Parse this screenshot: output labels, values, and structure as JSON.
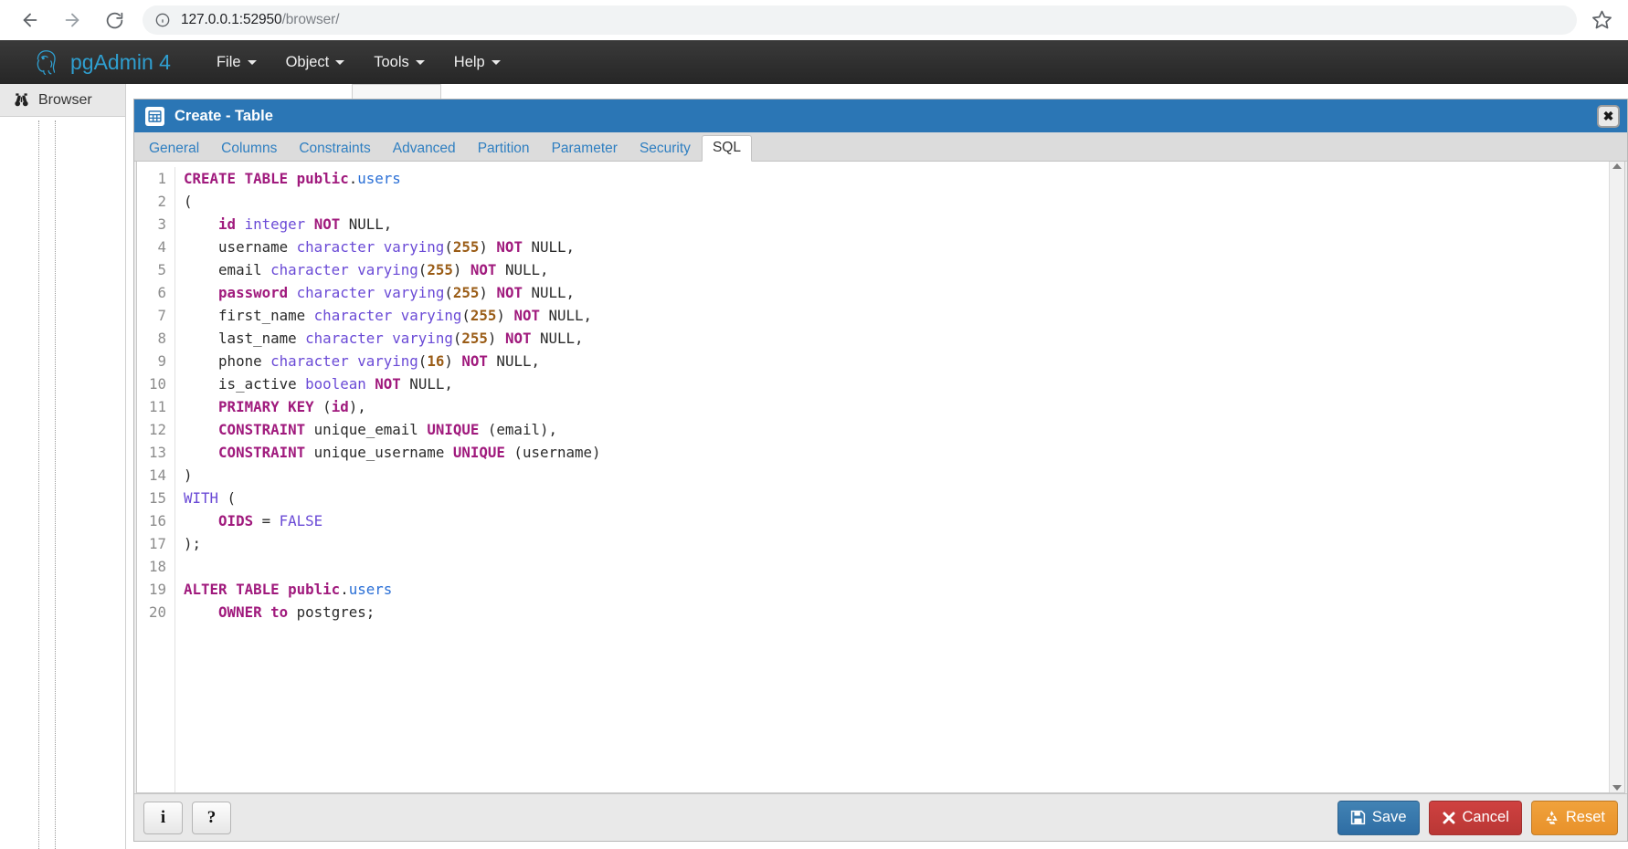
{
  "browser": {
    "url_host": "127.0.0.1:52950",
    "url_path": "/browser/",
    "back_icon": "arrow-left-icon",
    "forward_icon": "arrow-right-icon",
    "reload_icon": "reload-icon",
    "info_icon": "info-circle-icon",
    "star_icon": "star-icon"
  },
  "app": {
    "brand": "pgAdmin 4",
    "logo_icon": "postgresql-elephant-icon",
    "menus": [
      {
        "label": "File"
      },
      {
        "label": "Object"
      },
      {
        "label": "Tools"
      },
      {
        "label": "Help"
      }
    ]
  },
  "browser_panel": {
    "title": "Browser",
    "icon": "binoculars-icon"
  },
  "dialog": {
    "title": "Create - Table",
    "icon": "table-icon",
    "close_label": "✖",
    "tabs": [
      {
        "label": "General",
        "active": false
      },
      {
        "label": "Columns",
        "active": false
      },
      {
        "label": "Constraints",
        "active": false
      },
      {
        "label": "Advanced",
        "active": false
      },
      {
        "label": "Partition",
        "active": false
      },
      {
        "label": "Parameter",
        "active": false
      },
      {
        "label": "Security",
        "active": false
      },
      {
        "label": "SQL",
        "active": true
      }
    ],
    "active_tab": "SQL",
    "footer": {
      "info_label": "i",
      "help_label": "?",
      "save_label": "Save",
      "cancel_label": "Cancel",
      "reset_label": "Reset",
      "save_icon": "floppy-disk-icon",
      "cancel_icon": "x-mark-icon",
      "reset_icon": "recycle-icon"
    }
  },
  "sql": {
    "language": "postgresql",
    "line_count": 20,
    "line_numbers": [
      1,
      2,
      3,
      4,
      5,
      6,
      7,
      8,
      9,
      10,
      11,
      12,
      13,
      14,
      15,
      16,
      17,
      18,
      19,
      20
    ],
    "plain_text": "CREATE TABLE public.users\n(\n    id integer NOT NULL,\n    username character varying(255) NOT NULL,\n    email character varying(255) NOT NULL,\n    password character varying(255) NOT NULL,\n    first_name character varying(255) NOT NULL,\n    last_name character varying(255) NOT NULL,\n    phone character varying(16) NOT NULL,\n    is_active boolean NOT NULL,\n    PRIMARY KEY (id),\n    CONSTRAINT unique_email UNIQUE (email),\n    CONSTRAINT unique_username UNIQUE (username)\n)\nWITH (\n    OIDS = FALSE\n);\n\nALTER TABLE public.users\n    OWNER to postgres;",
    "lines": [
      {
        "n": 1,
        "tokens": [
          {
            "t": "k",
            "v": "CREATE TABLE public"
          },
          {
            "t": "pl",
            "v": "."
          },
          {
            "t": "obj",
            "v": "users"
          }
        ]
      },
      {
        "n": 2,
        "tokens": [
          {
            "t": "pl",
            "v": "("
          }
        ]
      },
      {
        "n": 3,
        "tokens": [
          {
            "t": "pl",
            "v": "    "
          },
          {
            "t": "k",
            "v": "id"
          },
          {
            "t": "pl",
            "v": " "
          },
          {
            "t": "t",
            "v": "integer"
          },
          {
            "t": "pl",
            "v": " "
          },
          {
            "t": "k",
            "v": "NOT"
          },
          {
            "t": "pl",
            "v": " NULL,"
          }
        ]
      },
      {
        "n": 4,
        "tokens": [
          {
            "t": "pl",
            "v": "    username "
          },
          {
            "t": "t",
            "v": "character varying"
          },
          {
            "t": "pl",
            "v": "("
          },
          {
            "t": "num",
            "v": "255"
          },
          {
            "t": "pl",
            "v": ") "
          },
          {
            "t": "k",
            "v": "NOT"
          },
          {
            "t": "pl",
            "v": " NULL,"
          }
        ]
      },
      {
        "n": 5,
        "tokens": [
          {
            "t": "pl",
            "v": "    email "
          },
          {
            "t": "t",
            "v": "character varying"
          },
          {
            "t": "pl",
            "v": "("
          },
          {
            "t": "num",
            "v": "255"
          },
          {
            "t": "pl",
            "v": ") "
          },
          {
            "t": "k",
            "v": "NOT"
          },
          {
            "t": "pl",
            "v": " NULL,"
          }
        ]
      },
      {
        "n": 6,
        "tokens": [
          {
            "t": "pl",
            "v": "    "
          },
          {
            "t": "k",
            "v": "password"
          },
          {
            "t": "pl",
            "v": " "
          },
          {
            "t": "t",
            "v": "character varying"
          },
          {
            "t": "pl",
            "v": "("
          },
          {
            "t": "num",
            "v": "255"
          },
          {
            "t": "pl",
            "v": ") "
          },
          {
            "t": "k",
            "v": "NOT"
          },
          {
            "t": "pl",
            "v": " NULL,"
          }
        ]
      },
      {
        "n": 7,
        "tokens": [
          {
            "t": "pl",
            "v": "    first_name "
          },
          {
            "t": "t",
            "v": "character varying"
          },
          {
            "t": "pl",
            "v": "("
          },
          {
            "t": "num",
            "v": "255"
          },
          {
            "t": "pl",
            "v": ") "
          },
          {
            "t": "k",
            "v": "NOT"
          },
          {
            "t": "pl",
            "v": " NULL,"
          }
        ]
      },
      {
        "n": 8,
        "tokens": [
          {
            "t": "pl",
            "v": "    last_name "
          },
          {
            "t": "t",
            "v": "character varying"
          },
          {
            "t": "pl",
            "v": "("
          },
          {
            "t": "num",
            "v": "255"
          },
          {
            "t": "pl",
            "v": ") "
          },
          {
            "t": "k",
            "v": "NOT"
          },
          {
            "t": "pl",
            "v": " NULL,"
          }
        ]
      },
      {
        "n": 9,
        "tokens": [
          {
            "t": "pl",
            "v": "    phone "
          },
          {
            "t": "t",
            "v": "character varying"
          },
          {
            "t": "pl",
            "v": "("
          },
          {
            "t": "num",
            "v": "16"
          },
          {
            "t": "pl",
            "v": ") "
          },
          {
            "t": "k",
            "v": "NOT"
          },
          {
            "t": "pl",
            "v": " NULL,"
          }
        ]
      },
      {
        "n": 10,
        "tokens": [
          {
            "t": "pl",
            "v": "    is_active "
          },
          {
            "t": "t",
            "v": "boolean"
          },
          {
            "t": "pl",
            "v": " "
          },
          {
            "t": "k",
            "v": "NOT"
          },
          {
            "t": "pl",
            "v": " NULL,"
          }
        ]
      },
      {
        "n": 11,
        "tokens": [
          {
            "t": "pl",
            "v": "    "
          },
          {
            "t": "k",
            "v": "PRIMARY KEY"
          },
          {
            "t": "pl",
            "v": " ("
          },
          {
            "t": "k",
            "v": "id"
          },
          {
            "t": "pl",
            "v": "),"
          }
        ]
      },
      {
        "n": 12,
        "tokens": [
          {
            "t": "pl",
            "v": "    "
          },
          {
            "t": "k",
            "v": "CONSTRAINT"
          },
          {
            "t": "pl",
            "v": " unique_email "
          },
          {
            "t": "k",
            "v": "UNIQUE"
          },
          {
            "t": "pl",
            "v": " (email),"
          }
        ]
      },
      {
        "n": 13,
        "tokens": [
          {
            "t": "pl",
            "v": "    "
          },
          {
            "t": "k",
            "v": "CONSTRAINT"
          },
          {
            "t": "pl",
            "v": " unique_username "
          },
          {
            "t": "k",
            "v": "UNIQUE"
          },
          {
            "t": "pl",
            "v": " (username)"
          }
        ]
      },
      {
        "n": 14,
        "tokens": [
          {
            "t": "pl",
            "v": ")"
          }
        ]
      },
      {
        "n": 15,
        "tokens": [
          {
            "t": "t",
            "v": "WITH"
          },
          {
            "t": "pl",
            "v": " ("
          }
        ]
      },
      {
        "n": 16,
        "tokens": [
          {
            "t": "pl",
            "v": "    "
          },
          {
            "t": "k",
            "v": "OIDS"
          },
          {
            "t": "pl",
            "v": " = "
          },
          {
            "t": "t",
            "v": "FALSE"
          }
        ]
      },
      {
        "n": 17,
        "tokens": [
          {
            "t": "pl",
            "v": ");"
          }
        ]
      },
      {
        "n": 18,
        "tokens": []
      },
      {
        "n": 19,
        "tokens": [
          {
            "t": "k",
            "v": "ALTER TABLE public"
          },
          {
            "t": "pl",
            "v": "."
          },
          {
            "t": "obj",
            "v": "users"
          }
        ]
      },
      {
        "n": 20,
        "tokens": [
          {
            "t": "pl",
            "v": "    "
          },
          {
            "t": "k",
            "v": "OWNER to"
          },
          {
            "t": "pl",
            "v": " postgres;"
          }
        ]
      }
    ]
  },
  "colors": {
    "dialog_header": "#2b76b5",
    "topbar": "#2f2f2f",
    "brand": "#2f9fd0",
    "tab_link": "#2f7fc1",
    "keyword": "#a01a7d",
    "type": "#6a4ad6",
    "number": "#9a5c16",
    "identifier": "#2a6fd6",
    "save": "#2e6da4",
    "cancel": "#b93735",
    "reset": "#e8912a"
  }
}
